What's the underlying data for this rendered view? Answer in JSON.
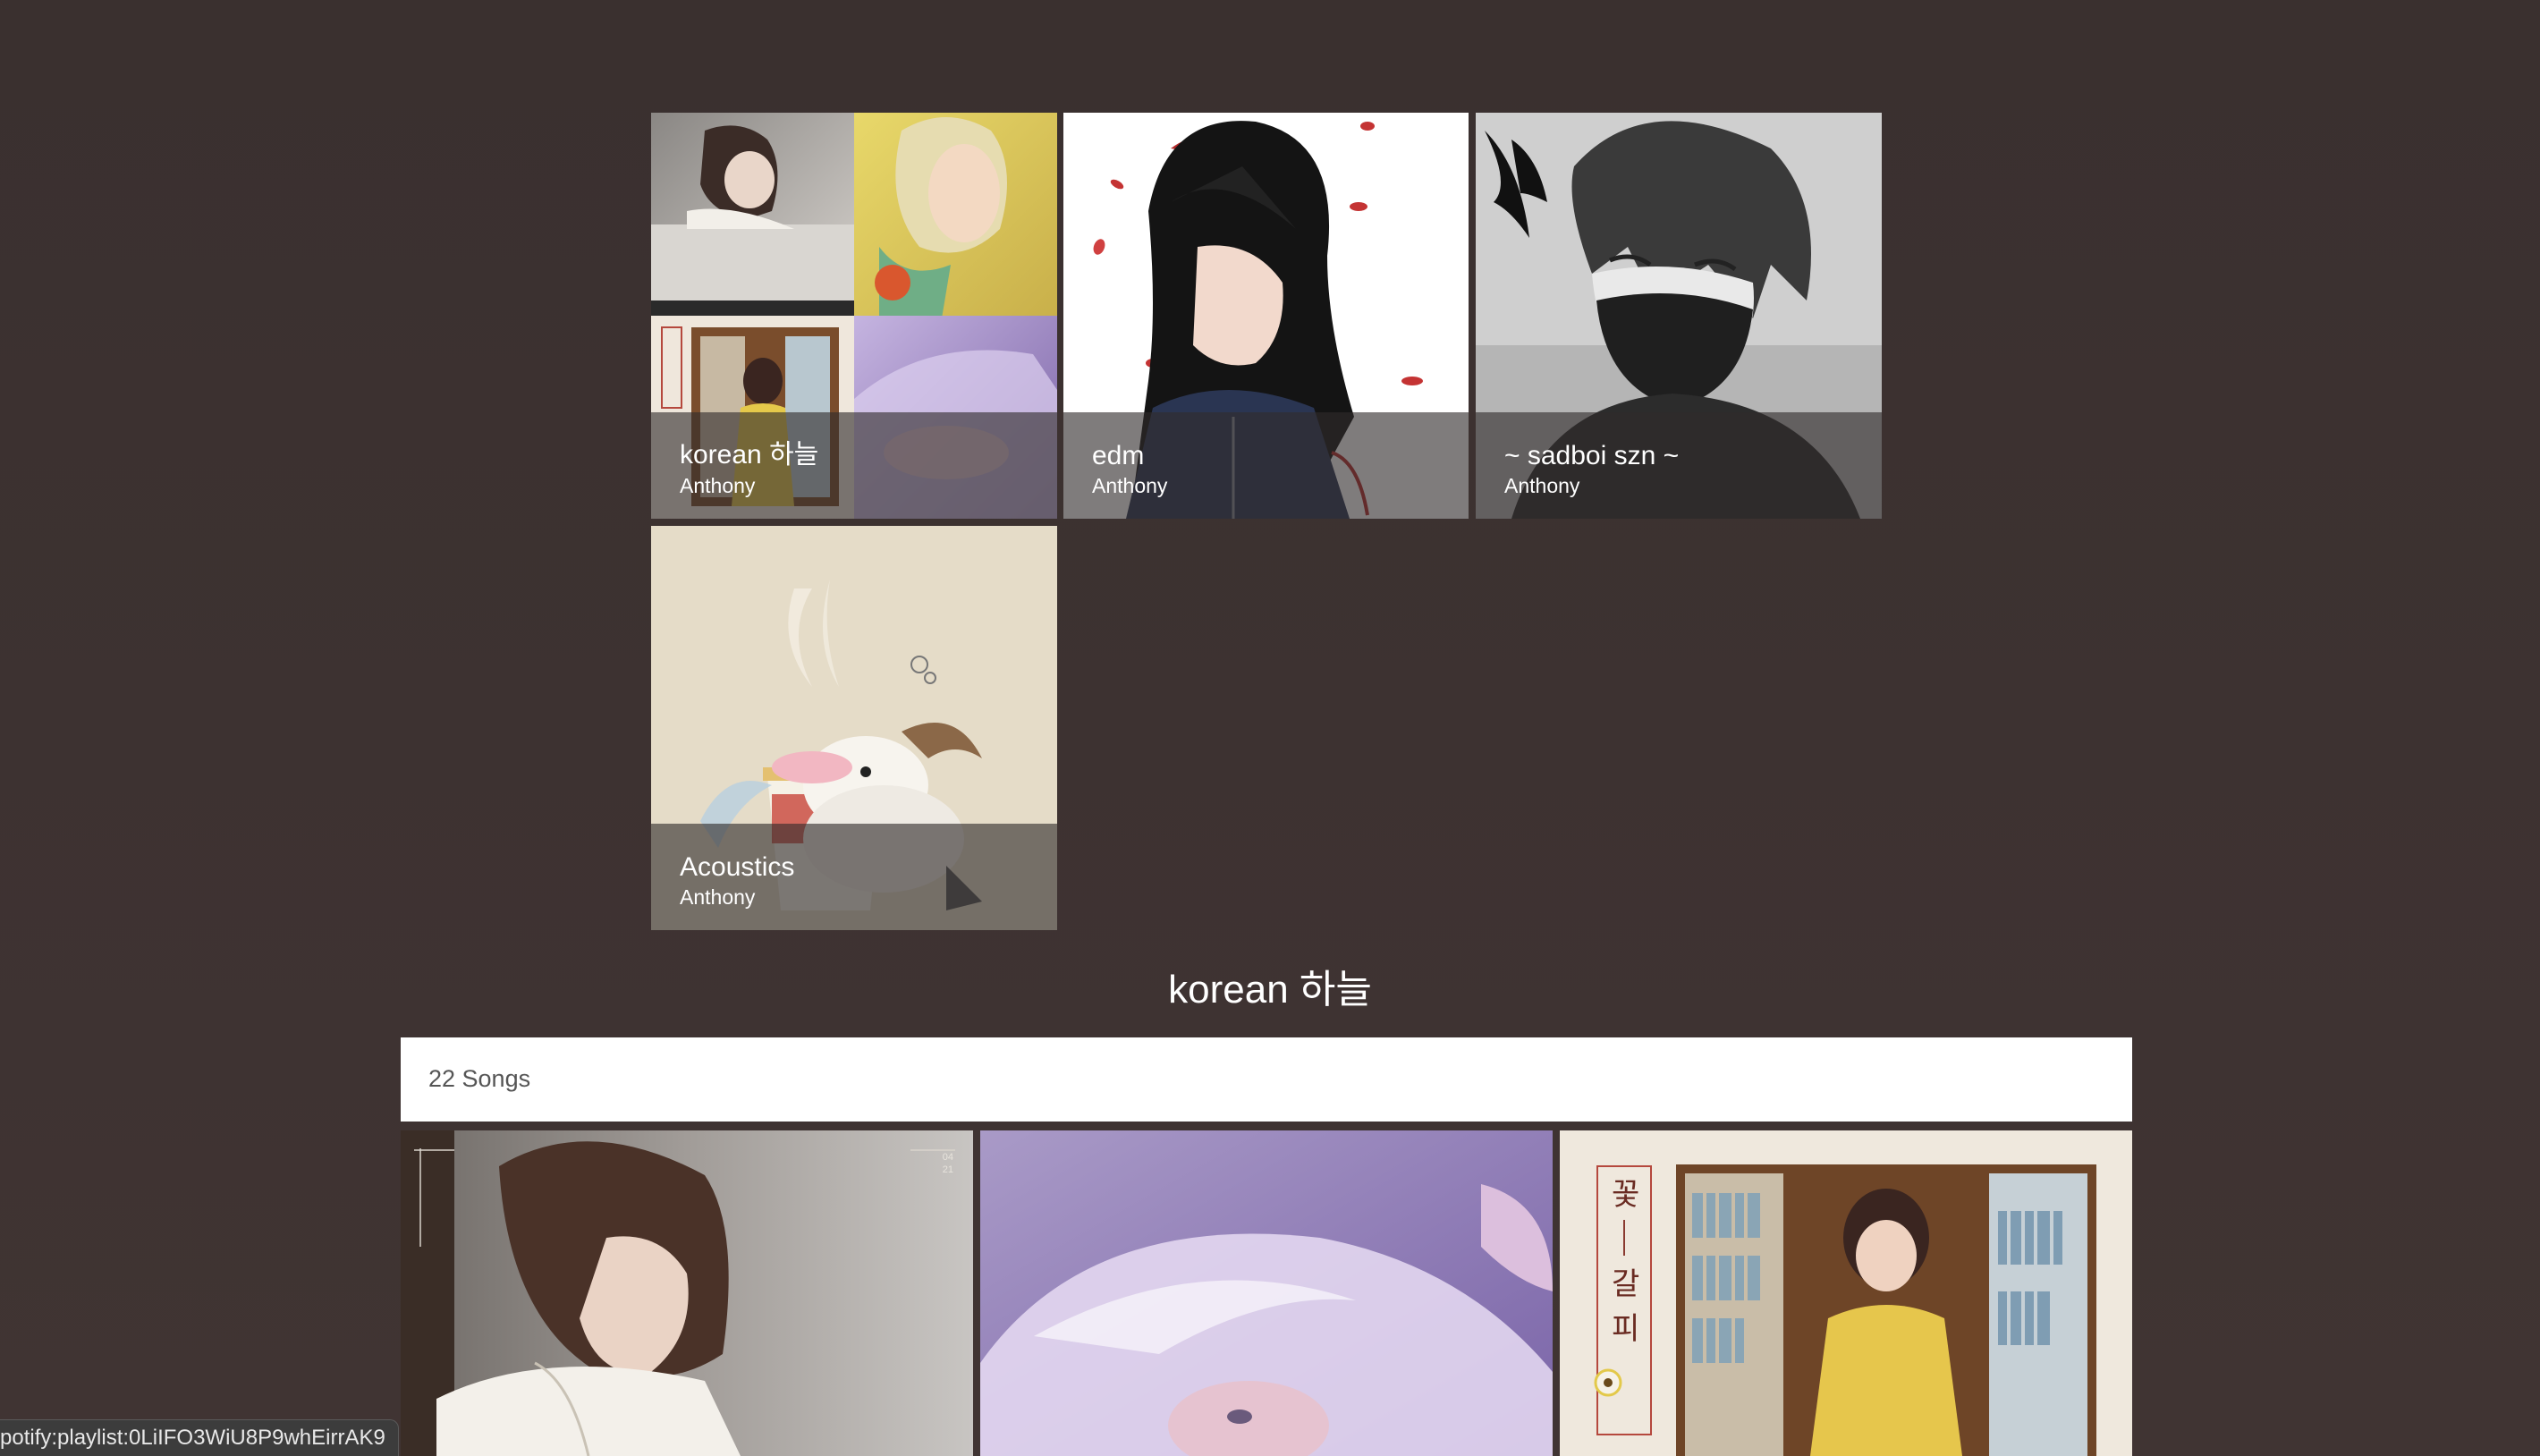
{
  "playlists": [
    {
      "title": "korean 하늘",
      "owner": "Anthony",
      "art": "four-album-mosaic"
    },
    {
      "title": "edm",
      "owner": "Anthony",
      "art": "anime-girl-black-hair"
    },
    {
      "title": "~ sadboi szn ~",
      "owner": "Anthony",
      "art": "masked-anime-boy"
    },
    {
      "title": "Acoustics",
      "owner": "Anthony",
      "art": "poro-ramen-cup"
    }
  ],
  "selected_playlist": {
    "title": "korean 하늘",
    "song_count": "22 Songs"
  },
  "song_cards": [
    {
      "art": "woman-looking-down"
    },
    {
      "art": "purple-hair-portrait"
    },
    {
      "art": "girl-in-bookstore"
    }
  ],
  "song_card_texts": {
    "date_top": "04",
    "date_bottom": "21",
    "hangul": [
      "꽃",
      "갈",
      "피"
    ]
  },
  "status_bar": {
    "url": "potify:playlist:0LiIFO3WiU8P9whEirrAK9"
  },
  "colors": {
    "background": "#3e3231",
    "overlay": "rgba(48,44,44,0.62)",
    "text": "#ffffff"
  }
}
